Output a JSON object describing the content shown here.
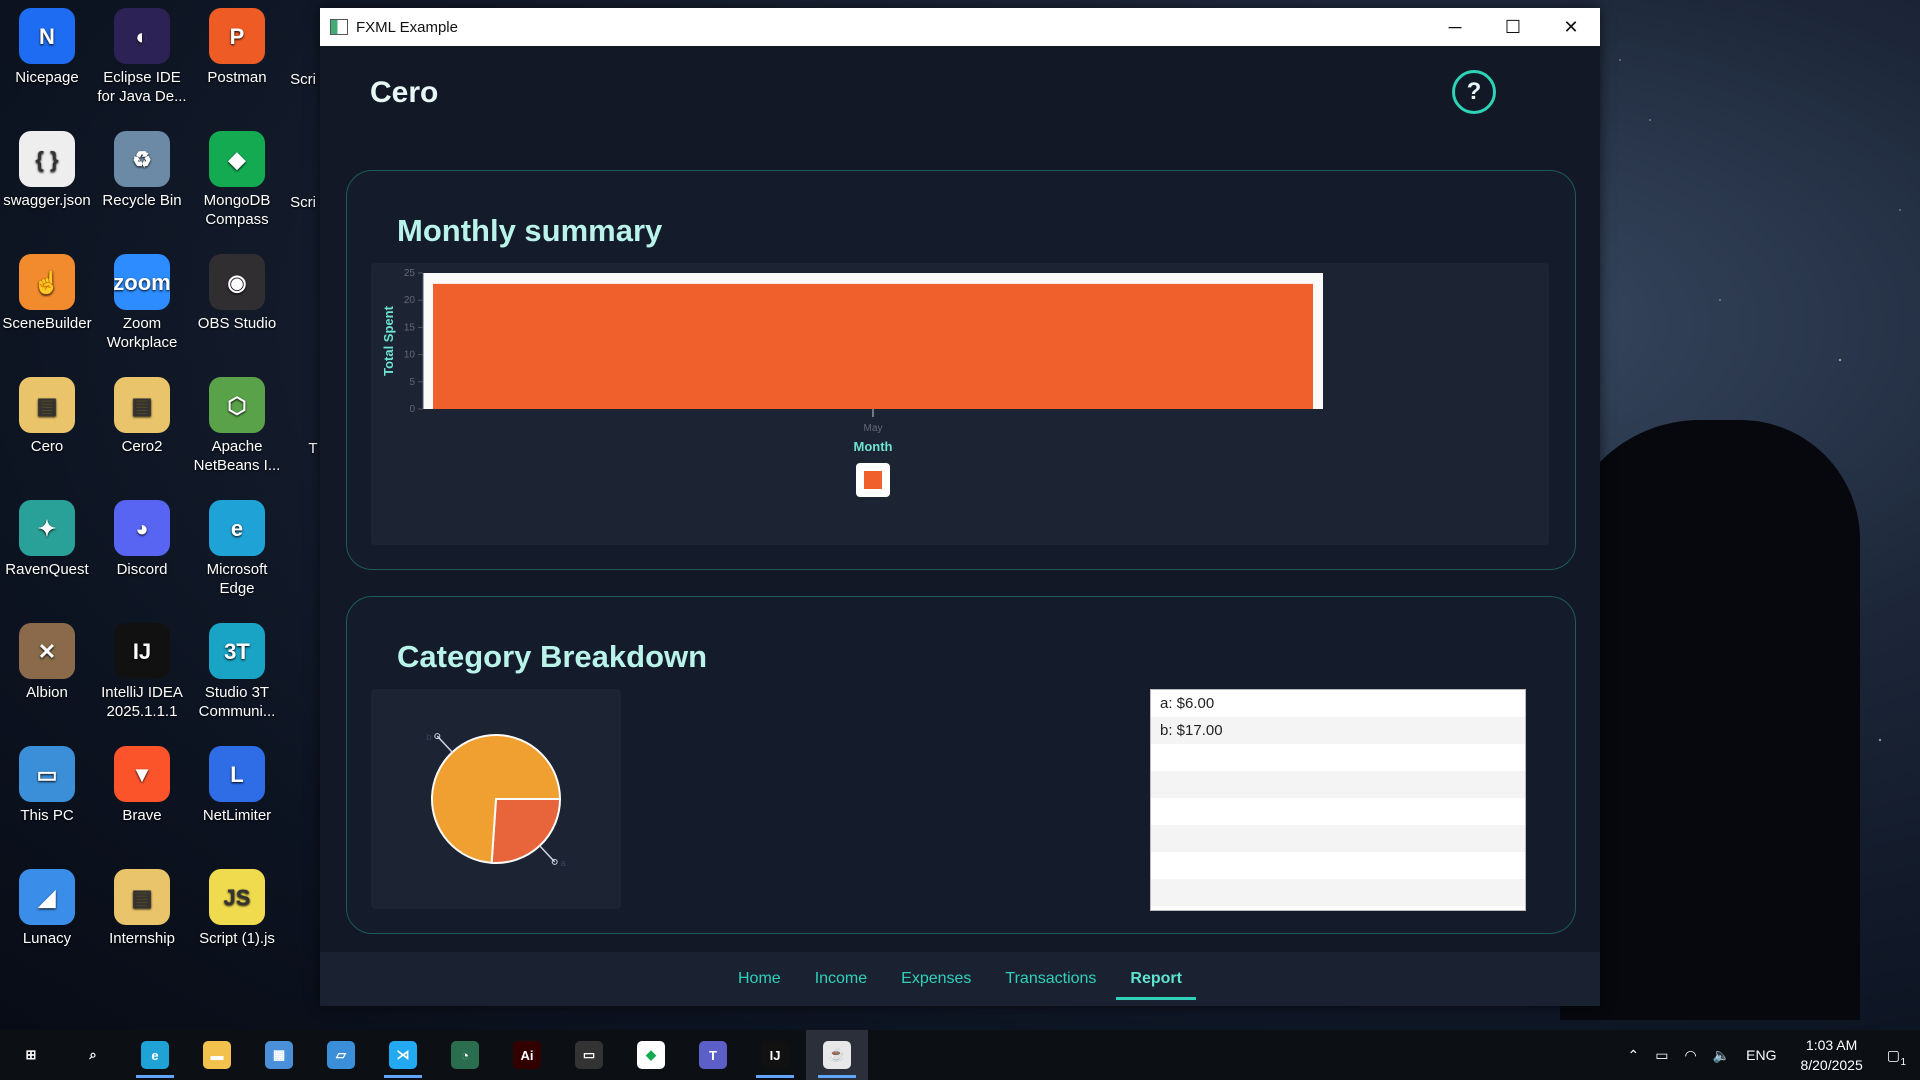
{
  "desktop": {
    "icons": [
      {
        "label": "Nicepage",
        "glyph": "N",
        "color": "#1d6cf2"
      },
      {
        "label": "Eclipse IDE for Java De...",
        "glyph": "◐",
        "color": "#2c2255"
      },
      {
        "label": "Postman",
        "glyph": "P",
        "color": "#ef5b25"
      },
      {
        "label": "swagger.json",
        "glyph": "{ }",
        "color": "#eeeeee"
      },
      {
        "label": "Recycle Bin",
        "glyph": "♻",
        "color": "#6c8aa6"
      },
      {
        "label": "MongoDB Compass",
        "glyph": "◆",
        "color": "#13aa52"
      },
      {
        "label": "SceneBuilder",
        "glyph": "☝",
        "color": "#f28a2e"
      },
      {
        "label": "Zoom Workplace",
        "glyph": "zoom",
        "color": "#2d8cff"
      },
      {
        "label": "OBS Studio",
        "glyph": "◉",
        "color": "#302e31"
      },
      {
        "label": "Cero",
        "glyph": "▤",
        "color": "#e9c46a"
      },
      {
        "label": "Cero2",
        "glyph": "▤",
        "color": "#e9c46a"
      },
      {
        "label": "Apache NetBeans I...",
        "glyph": "⬡",
        "color": "#5aa24a"
      },
      {
        "label": "RavenQuest",
        "glyph": "✦",
        "color": "#2aa198"
      },
      {
        "label": "Discord",
        "glyph": "◕",
        "color": "#5865f2"
      },
      {
        "label": "Microsoft Edge",
        "glyph": "e",
        "color": "#1fa3d6"
      },
      {
        "label": "Albion",
        "glyph": "✕",
        "color": "#8a6a4a"
      },
      {
        "label": "IntelliJ IDEA 2025.1.1.1",
        "glyph": "IJ",
        "color": "#111111"
      },
      {
        "label": "Studio 3T Communi...",
        "glyph": "3T",
        "color": "#19a3c4"
      },
      {
        "label": "This PC",
        "glyph": "▭",
        "color": "#3b8ed8"
      },
      {
        "label": "Brave",
        "glyph": "▼",
        "color": "#fb542b"
      },
      {
        "label": "NetLimiter",
        "glyph": "L",
        "color": "#2e6de6"
      },
      {
        "label": "Lunacy",
        "glyph": "◢",
        "color": "#3a8de8"
      },
      {
        "label": "Internship",
        "glyph": "▤",
        "color": "#e9c46a"
      },
      {
        "label": "Script (1).js",
        "glyph": "JS",
        "color": "#f0db4f"
      }
    ],
    "partial_labels": [
      "Scri",
      "Scri",
      "T"
    ]
  },
  "window": {
    "title": "FXML Example",
    "controls": {
      "minimize": "─",
      "maximize": "☐",
      "close": "✕"
    },
    "app_name": "Cero",
    "help_glyph": "?"
  },
  "monthly": {
    "title": "Monthly summary"
  },
  "category": {
    "title": "Category Breakdown",
    "list": [
      "a: $6.00",
      "b: $17.00",
      "",
      "",
      "",
      "",
      "",
      ""
    ]
  },
  "chart_data": [
    {
      "type": "bar",
      "categories": [
        "May"
      ],
      "values": [
        23
      ],
      "xlabel": "Month",
      "ylabel": "Total Spent",
      "ylim": [
        0,
        25
      ],
      "yticks": [
        "0",
        "5",
        "10",
        "15",
        "20",
        "25"
      ],
      "color": "#f0602d",
      "legend": "bottom"
    },
    {
      "type": "pie",
      "categories": [
        "a",
        "b"
      ],
      "values": [
        6,
        17
      ],
      "colors": [
        "#e8643a",
        "#f0a030"
      ],
      "slice_labels": [
        "a",
        "b"
      ]
    }
  ],
  "nav": {
    "tabs": [
      "Home",
      "Income",
      "Expenses",
      "Transactions",
      "Report"
    ],
    "active": "Report"
  },
  "taskbar": {
    "apps": [
      {
        "name": "start",
        "glyph": "⊞",
        "color": "#0c0f14"
      },
      {
        "name": "search",
        "glyph": "⌕",
        "color": "#0c0f14"
      },
      {
        "name": "edge",
        "glyph": "e",
        "color": "#1fa3d6"
      },
      {
        "name": "file-explorer",
        "glyph": "▬",
        "color": "#f2c14e"
      },
      {
        "name": "control-panel",
        "glyph": "▦",
        "color": "#4a90d9"
      },
      {
        "name": "remote-desktop",
        "glyph": "▱",
        "color": "#3b8ed8"
      },
      {
        "name": "vscode",
        "glyph": "⋊",
        "color": "#23a9f2"
      },
      {
        "name": "pspad",
        "glyph": "◔",
        "color": "#2b6e4f"
      },
      {
        "name": "illustrator",
        "glyph": "Ai",
        "color": "#330000"
      },
      {
        "name": "terminal",
        "glyph": "▭",
        "color": "#333333"
      },
      {
        "name": "mongodb",
        "glyph": "◆",
        "color": "#ffffff"
      },
      {
        "name": "teams",
        "glyph": "T",
        "color": "#5b5fc7"
      },
      {
        "name": "intellij",
        "glyph": "IJ",
        "color": "#111111"
      },
      {
        "name": "java",
        "glyph": "☕",
        "color": "#e8e8e8"
      }
    ],
    "tray": {
      "language": "ENG",
      "time": "1:03 AM",
      "date": "8/20/2025",
      "notifications": "1"
    }
  }
}
